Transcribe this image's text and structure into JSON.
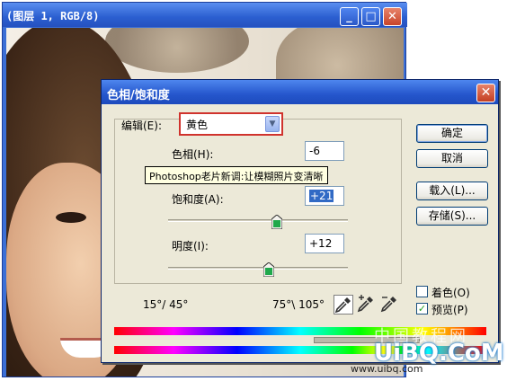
{
  "document_window": {
    "title": "(图层 1, RGB/8)",
    "controls": {
      "minimize": "_",
      "maximize": "□",
      "close": "✕"
    }
  },
  "dialog": {
    "title": "色相/饱和度",
    "close_glyph": "✕",
    "edit_label": "编辑(E):",
    "edit_value": "黄色",
    "hue_label": "色相(H):",
    "hue_value": "-6",
    "saturation_label": "饱和度(A):",
    "saturation_value": "+21",
    "lightness_label": "明度(I):",
    "lightness_value": "+12",
    "range_left": "15°/ 45°",
    "range_right": "75°\\ 105°",
    "buttons": {
      "ok": "确定",
      "cancel": "取消",
      "load": "载入(L)...",
      "save": "存储(S)..."
    },
    "colorize_label": "着色(O)",
    "colorize_checked": false,
    "preview_label": "预览(P)",
    "preview_checked": true,
    "sliders": {
      "hue_level": -6,
      "saturation_level": 21,
      "lightness_level": 12
    },
    "tooltip": "Photoshop老片新调:让模糊照片变清晰"
  },
  "watermark": {
    "chinese": "中国教程网",
    "brand": "UiBQ.CoM",
    "small": "www.uibq.com"
  },
  "colors": {
    "titlebar": "#2556cc",
    "dialog_bg": "#ece9d8",
    "highlight_box": "#d0332d",
    "selection": "#316ac5"
  }
}
